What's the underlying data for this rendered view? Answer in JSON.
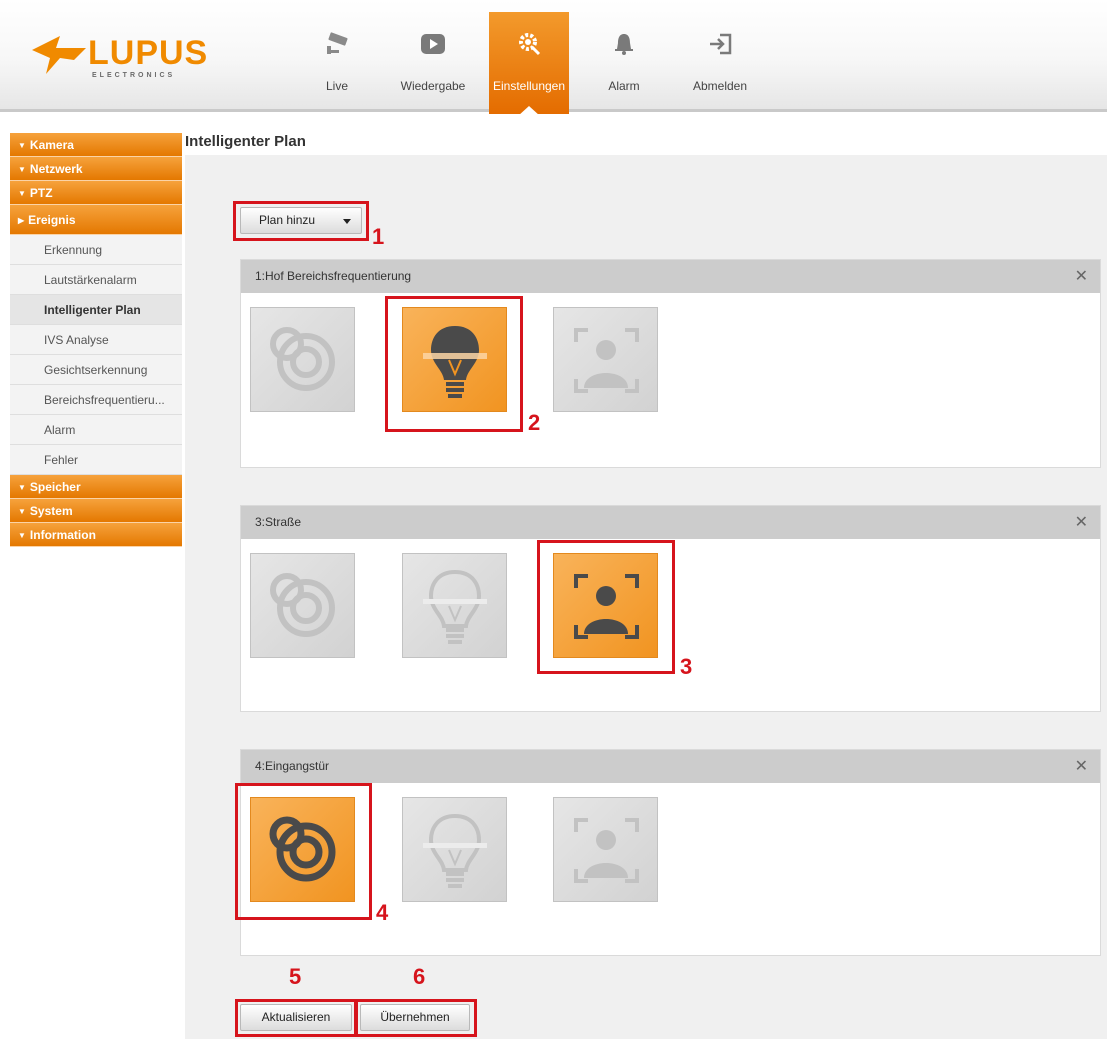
{
  "header": {
    "logo": {
      "word": "LUPUS",
      "sub": "ELECTRONICS"
    },
    "nav": [
      {
        "label": "Live",
        "icon": "camera-icon"
      },
      {
        "label": "Wiedergabe",
        "icon": "play-icon"
      },
      {
        "label": "Einstellungen",
        "icon": "settings-icon",
        "active": true
      },
      {
        "label": "Alarm",
        "icon": "bell-icon"
      },
      {
        "label": "Abmelden",
        "icon": "logout-icon"
      }
    ]
  },
  "sidebar": {
    "items": [
      {
        "label": "Kamera",
        "type": "group"
      },
      {
        "label": "Netzwerk",
        "type": "group"
      },
      {
        "label": "PTZ",
        "type": "group"
      },
      {
        "label": "Ereignis",
        "type": "group",
        "expanded": true
      },
      {
        "label": "Erkennung",
        "type": "sub"
      },
      {
        "label": "Lautstärkenalarm",
        "type": "sub"
      },
      {
        "label": "Intelligenter Plan",
        "type": "sub",
        "active": true
      },
      {
        "label": "IVS Analyse",
        "type": "sub"
      },
      {
        "label": "Gesichtserkennung",
        "type": "sub"
      },
      {
        "label": "Bereichsfrequentieru...",
        "type": "sub"
      },
      {
        "label": "Alarm",
        "type": "sub"
      },
      {
        "label": "Fehler",
        "type": "sub"
      },
      {
        "label": "Speicher",
        "type": "group"
      },
      {
        "label": "System",
        "type": "group"
      },
      {
        "label": "Information",
        "type": "group"
      }
    ]
  },
  "main": {
    "title": "Intelligenter Plan",
    "add_plan_label": "Plan hinzu",
    "plans": [
      {
        "title": "1:Hof Bereichsfrequentierung",
        "active_tile": 1
      },
      {
        "title": "3:Straße",
        "active_tile": 2
      },
      {
        "title": "4:Eingangstür",
        "active_tile": 0
      }
    ],
    "tile_icons": [
      "target-icon",
      "lightbulb-icon",
      "face-detection-icon"
    ],
    "refresh_label": "Aktualisieren",
    "apply_label": "Übernehmen"
  },
  "callouts": [
    "1",
    "2",
    "3",
    "4",
    "5",
    "6"
  ],
  "colors": {
    "accent": "#f08a00",
    "callout": "#d6141c"
  }
}
